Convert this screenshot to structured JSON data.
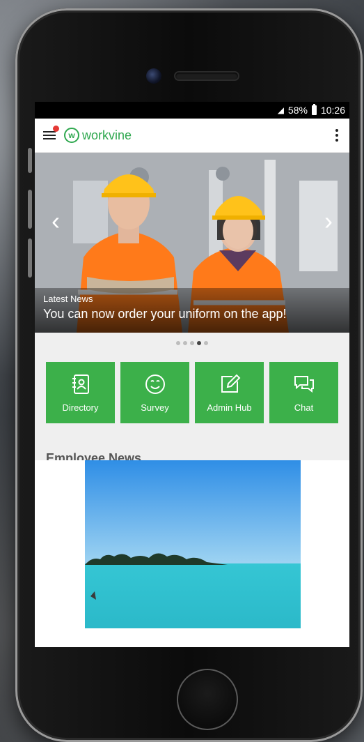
{
  "status_bar": {
    "battery": "58%",
    "time": "10:26"
  },
  "app_bar": {
    "brand": "workvine",
    "logo_letter": "w"
  },
  "carousel": {
    "kicker": "Latest News",
    "title": "You can now order your uniform on the app!",
    "prev_arrow": "‹",
    "next_arrow": "›",
    "slide_count": 5,
    "active_slide": 4
  },
  "tiles": [
    {
      "label": "Directory",
      "icon": "contact-book-icon"
    },
    {
      "label": "Survey",
      "icon": "smiley-icon"
    },
    {
      "label": "Admin Hub",
      "icon": "edit-icon"
    },
    {
      "label": "Chat",
      "icon": "chat-bubbles-icon"
    }
  ],
  "section": {
    "title": "Employee News"
  },
  "colors": {
    "brand_green": "#2fa84f",
    "tile_green": "#3cb04a",
    "badge_red": "#e53935"
  }
}
